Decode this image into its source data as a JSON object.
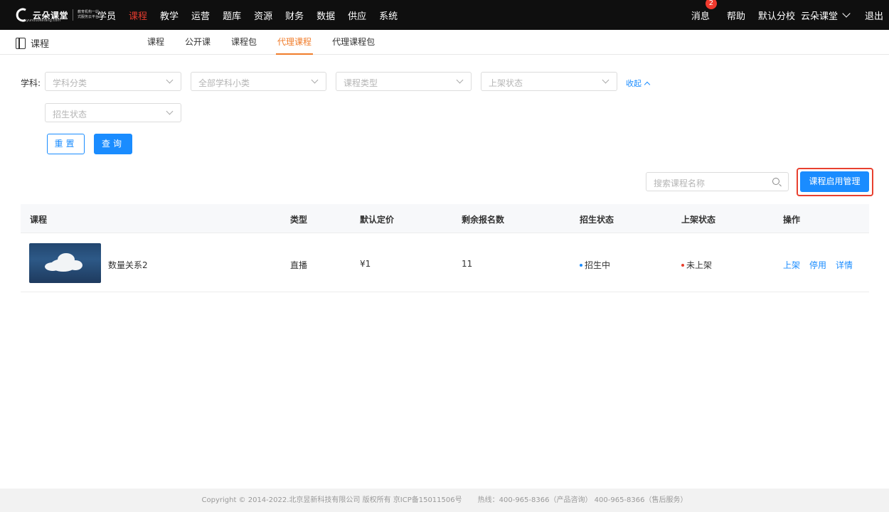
{
  "brand": {
    "name": "云朵课堂",
    "domain": "yunduoketang.com",
    "slogan": "教育机构一站式服务云平台"
  },
  "topnav": {
    "items": [
      "学员",
      "课程",
      "教学",
      "运营",
      "题库",
      "资源",
      "财务",
      "数据",
      "供应",
      "系统"
    ],
    "active_index": 1
  },
  "topright": {
    "messages": "消息",
    "badge": "2",
    "help": "帮助",
    "campus": "默认分校",
    "school": "云朵课堂",
    "logout": "退出"
  },
  "page": {
    "title": "课程"
  },
  "subtabs": {
    "items": [
      "课程",
      "公开课",
      "课程包",
      "代理课程",
      "代理课程包"
    ],
    "active_index": 3
  },
  "filters": {
    "label": "学科:",
    "subject_category": "学科分类",
    "subject_sub": "全部学科小类",
    "course_type": "课程类型",
    "shelf_status": "上架状态",
    "enroll_status": "招生状态",
    "collapse": "收起",
    "reset": "重置",
    "query": "查询"
  },
  "search": {
    "placeholder": "搜索课程名称"
  },
  "manage_button": "课程启用管理",
  "table": {
    "headers": [
      "课程",
      "类型",
      "默认定价",
      "剩余报名数",
      "招生状态",
      "上架状态",
      "操作"
    ],
    "rows": [
      {
        "name": "数量关系2",
        "type": "直播",
        "price": "¥1",
        "remaining": "11",
        "enroll_status": "招生中",
        "enroll_color": "#1a8cff",
        "shelf_status": "未上架",
        "shelf_color": "#e8402f",
        "actions": [
          "上架",
          "停用",
          "详情"
        ]
      }
    ]
  },
  "footer": {
    "copyright": "Copyright © 2014-2022.北京昱新科技有限公司 版权所有 京ICP备15011506号",
    "hotline": "热线：400-965-8366（产品咨询） 400-965-8366（售后服务）"
  },
  "colors": {
    "accent": "#1a8cff",
    "active_tab": "#f07c2a",
    "nav_active": "#e33b2e",
    "highlight": "#e8402f"
  }
}
